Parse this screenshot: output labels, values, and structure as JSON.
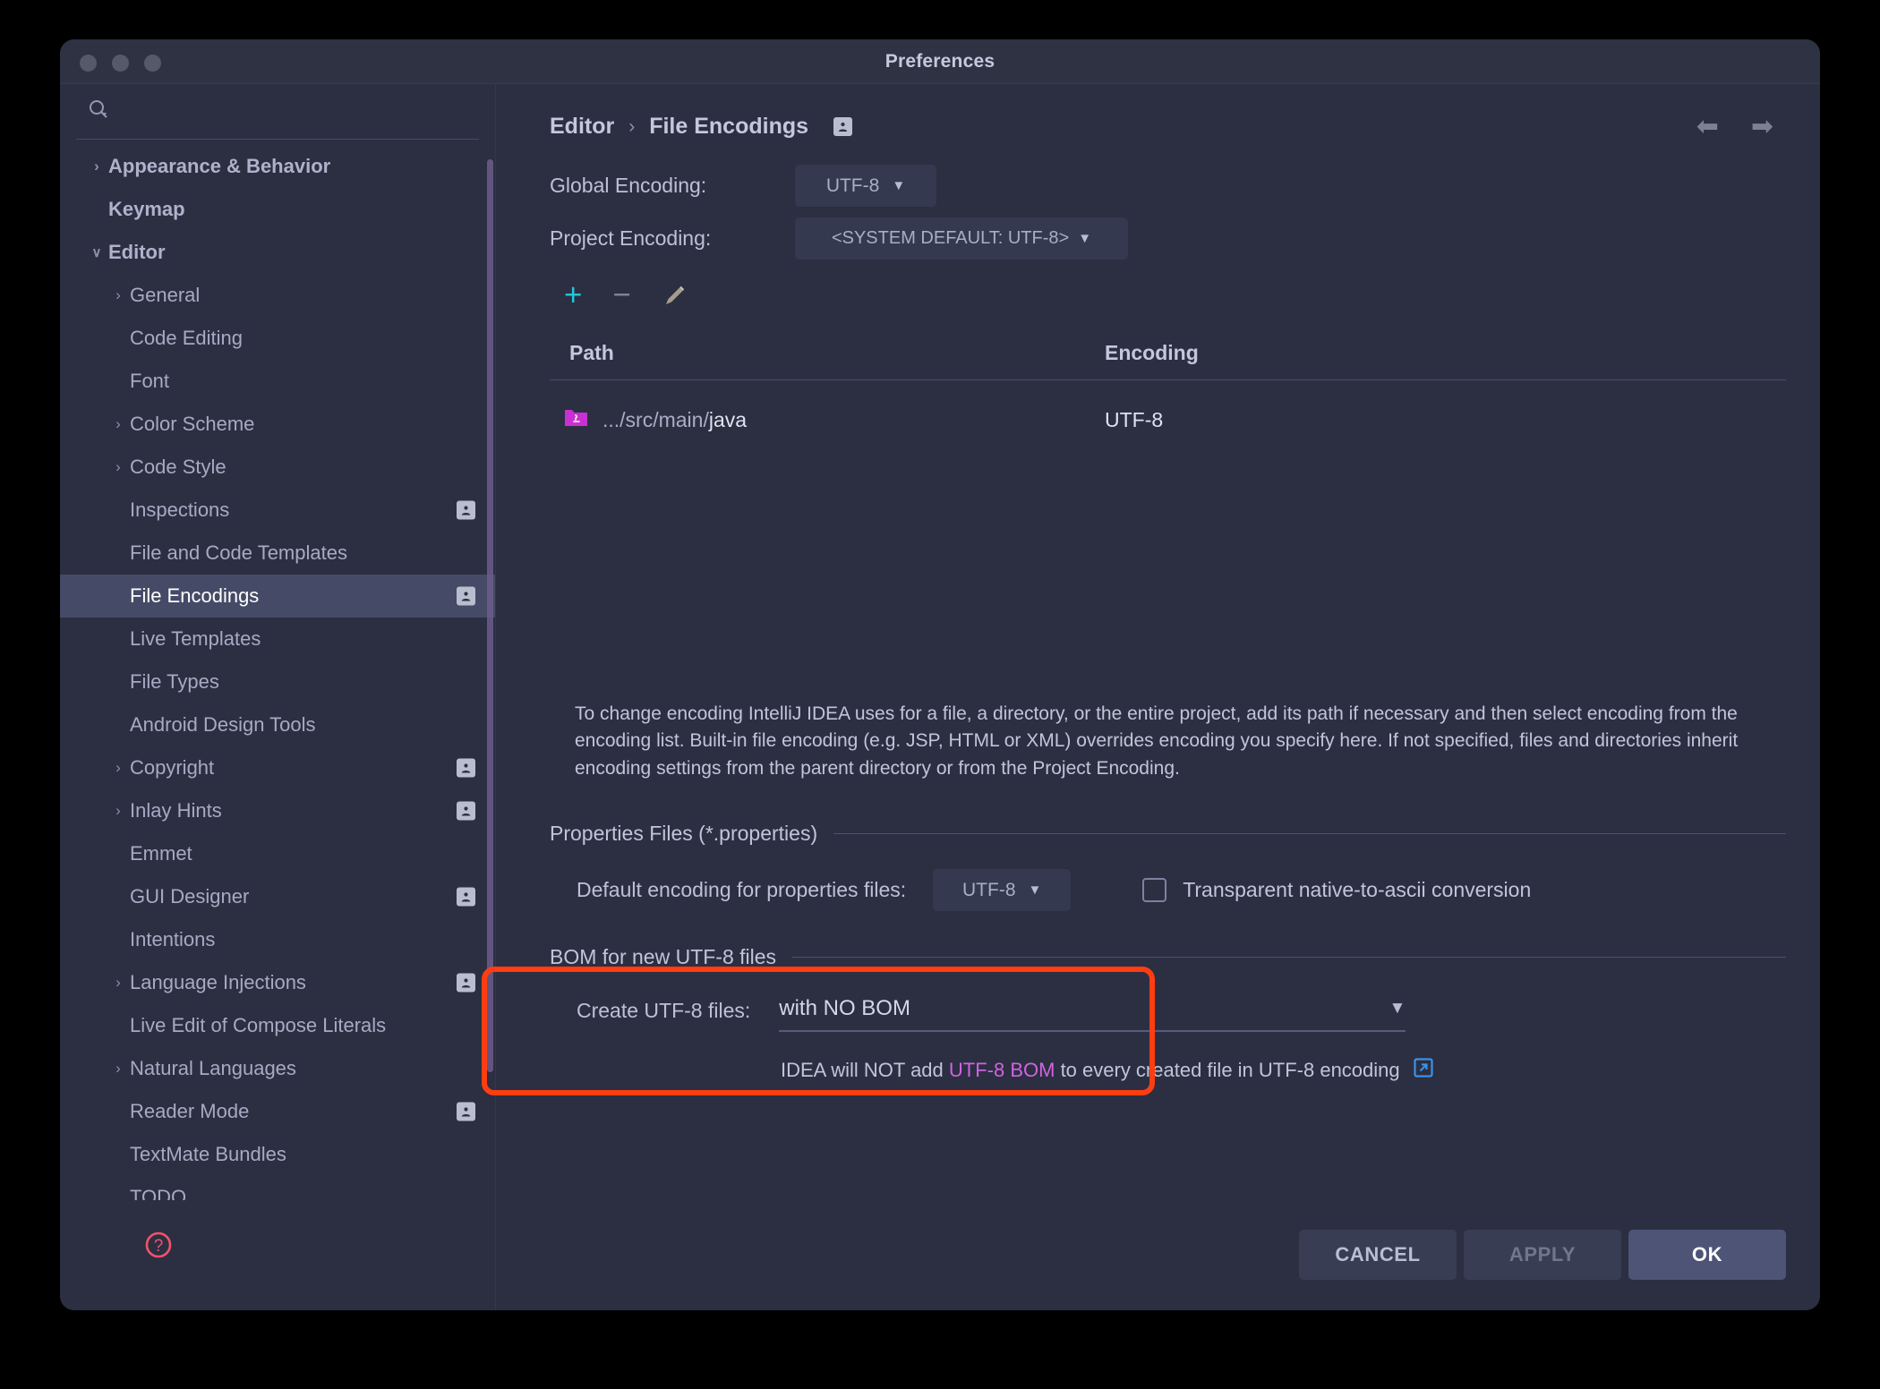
{
  "window": {
    "title": "Preferences"
  },
  "sidebar": {
    "search_placeholder": "",
    "items": [
      {
        "label": "Appearance & Behavior",
        "level": 0,
        "arrow": "right",
        "bold": true,
        "badge": false,
        "selected": false
      },
      {
        "label": "Keymap",
        "level": 0,
        "arrow": "none",
        "bold": true,
        "badge": false,
        "selected": false
      },
      {
        "label": "Editor",
        "level": 0,
        "arrow": "down",
        "bold": true,
        "badge": false,
        "selected": false
      },
      {
        "label": "General",
        "level": 1,
        "arrow": "right",
        "bold": false,
        "badge": false,
        "selected": false
      },
      {
        "label": "Code Editing",
        "level": 1,
        "arrow": "none",
        "bold": false,
        "badge": false,
        "selected": false
      },
      {
        "label": "Font",
        "level": 1,
        "arrow": "none",
        "bold": false,
        "badge": false,
        "selected": false
      },
      {
        "label": "Color Scheme",
        "level": 1,
        "arrow": "right",
        "bold": false,
        "badge": false,
        "selected": false
      },
      {
        "label": "Code Style",
        "level": 1,
        "arrow": "right",
        "bold": false,
        "badge": false,
        "selected": false
      },
      {
        "label": "Inspections",
        "level": 1,
        "arrow": "none",
        "bold": false,
        "badge": true,
        "selected": false
      },
      {
        "label": "File and Code Templates",
        "level": 1,
        "arrow": "none",
        "bold": false,
        "badge": false,
        "selected": false
      },
      {
        "label": "File Encodings",
        "level": 1,
        "arrow": "none",
        "bold": false,
        "badge": true,
        "selected": true
      },
      {
        "label": "Live Templates",
        "level": 1,
        "arrow": "none",
        "bold": false,
        "badge": false,
        "selected": false
      },
      {
        "label": "File Types",
        "level": 1,
        "arrow": "none",
        "bold": false,
        "badge": false,
        "selected": false
      },
      {
        "label": "Android Design Tools",
        "level": 1,
        "arrow": "none",
        "bold": false,
        "badge": false,
        "selected": false
      },
      {
        "label": "Copyright",
        "level": 1,
        "arrow": "right",
        "bold": false,
        "badge": true,
        "selected": false
      },
      {
        "label": "Inlay Hints",
        "level": 1,
        "arrow": "right",
        "bold": false,
        "badge": true,
        "selected": false
      },
      {
        "label": "Emmet",
        "level": 1,
        "arrow": "none",
        "bold": false,
        "badge": false,
        "selected": false
      },
      {
        "label": "GUI Designer",
        "level": 1,
        "arrow": "none",
        "bold": false,
        "badge": true,
        "selected": false
      },
      {
        "label": "Intentions",
        "level": 1,
        "arrow": "none",
        "bold": false,
        "badge": false,
        "selected": false
      },
      {
        "label": "Language Injections",
        "level": 1,
        "arrow": "right",
        "bold": false,
        "badge": true,
        "selected": false
      },
      {
        "label": "Live Edit of Compose Literals",
        "level": 1,
        "arrow": "none",
        "bold": false,
        "badge": false,
        "selected": false
      },
      {
        "label": "Natural Languages",
        "level": 1,
        "arrow": "right",
        "bold": false,
        "badge": false,
        "selected": false
      },
      {
        "label": "Reader Mode",
        "level": 1,
        "arrow": "none",
        "bold": false,
        "badge": true,
        "selected": false
      },
      {
        "label": "TextMate Bundles",
        "level": 1,
        "arrow": "none",
        "bold": false,
        "badge": false,
        "selected": false
      },
      {
        "label": "TODO",
        "level": 1,
        "arrow": "none",
        "bold": false,
        "badge": false,
        "selected": false
      }
    ]
  },
  "breadcrumb": {
    "root": "Editor",
    "separator": "›",
    "current": "File Encodings"
  },
  "encodings": {
    "global_label": "Global Encoding:",
    "global_value": "UTF-8",
    "project_label": "Project Encoding:",
    "project_value": "<SYSTEM DEFAULT: UTF-8>"
  },
  "table": {
    "headers": {
      "path": "Path",
      "encoding": "Encoding"
    },
    "rows": [
      {
        "path_prefix": ".../src/main/",
        "path_name": "java",
        "encoding": "UTF-8"
      }
    ]
  },
  "description": "To change encoding IntelliJ IDEA uses for a file, a directory, or the entire project, add its path if necessary and then select encoding from the encoding list. Built-in file encoding (e.g. JSP, HTML or XML) overrides encoding you specify here. If not specified, files and directories inherit encoding settings from the parent directory or from the Project Encoding.",
  "properties_section": {
    "title": "Properties Files (*.properties)",
    "default_encoding_label": "Default encoding for properties files:",
    "default_encoding_value": "UTF-8",
    "transparent_label": "Transparent native-to-ascii conversion",
    "transparent_checked": false
  },
  "bom_section": {
    "title": "BOM for new UTF-8 files",
    "create_label": "Create UTF-8 files:",
    "create_value": "with NO BOM",
    "note_before": "IDEA will NOT add ",
    "note_highlight": "UTF-8 BOM",
    "note_after": " to every created file in UTF-8 encoding"
  },
  "footer": {
    "cancel": "CANCEL",
    "apply": "APPLY",
    "ok": "OK"
  },
  "colors": {
    "accent_add": "#25c4d8",
    "highlight_box": "#ff3d11",
    "bom_link": "#d163e0",
    "help": "#f2526b",
    "folder": "#c930d4",
    "external_link": "#3b91e8"
  }
}
